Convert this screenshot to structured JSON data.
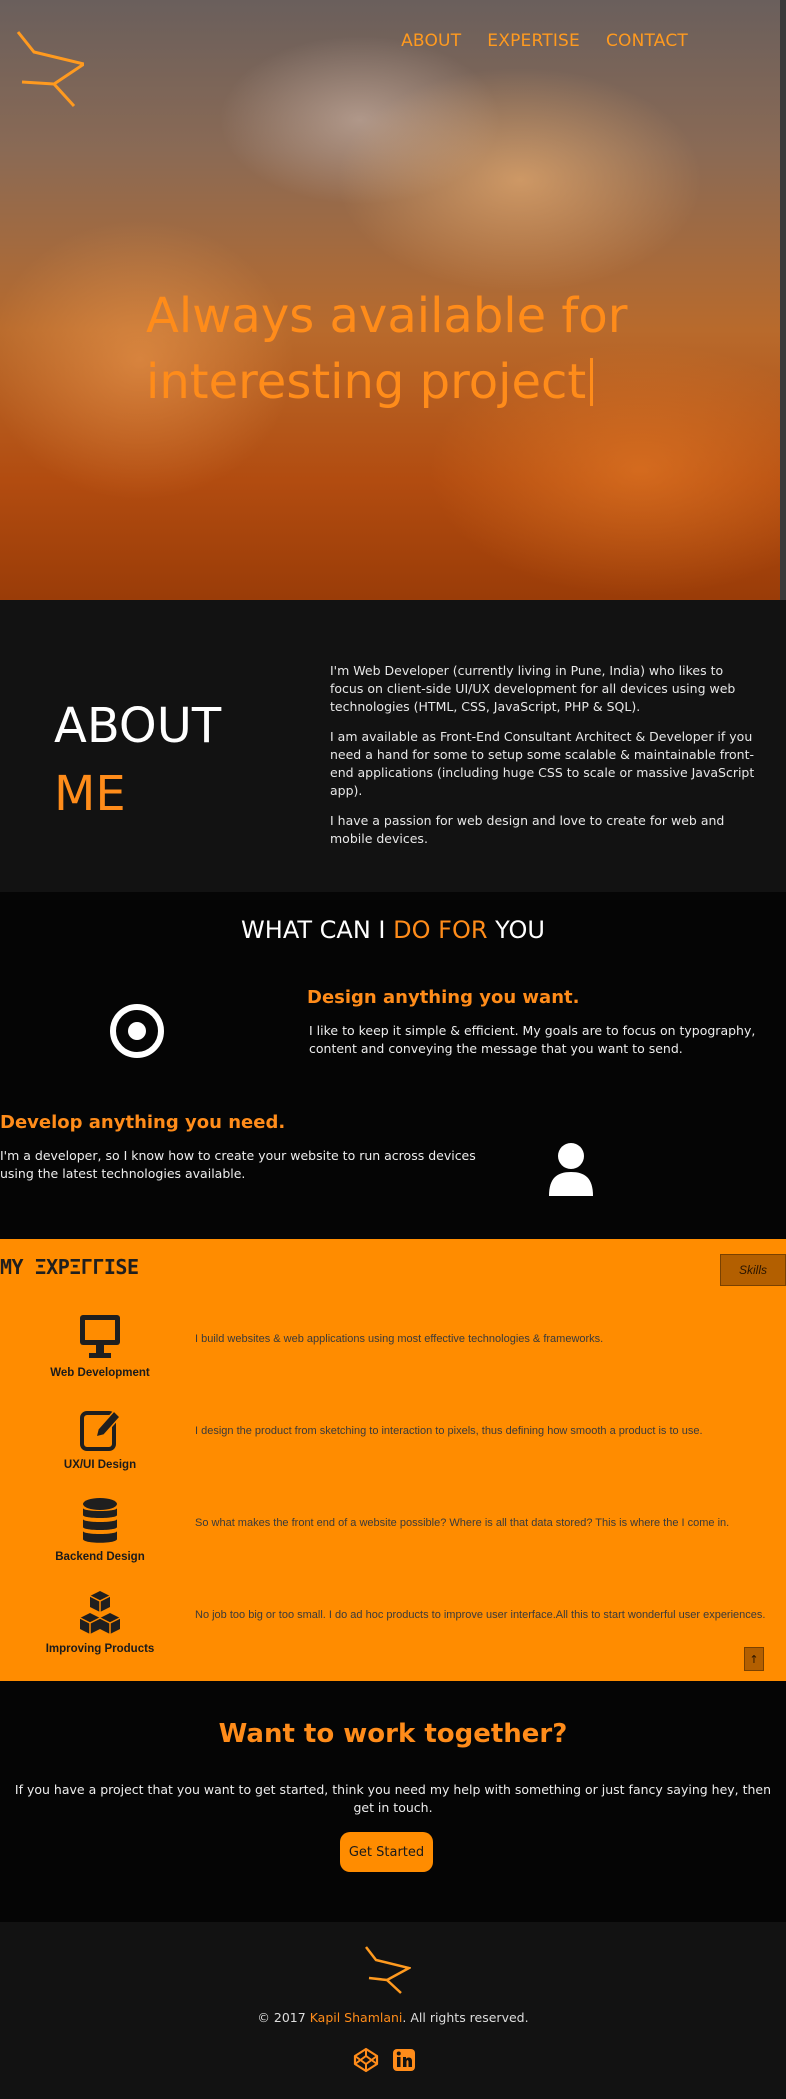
{
  "nav": {
    "items": [
      {
        "label": "ABOUT"
      },
      {
        "label": "EXPERTISE"
      },
      {
        "label": "CONTACT"
      }
    ]
  },
  "hero": {
    "line1": "Always available for",
    "line2": "interesting project"
  },
  "about": {
    "title_word1": "ABOUT",
    "title_word2": "ME",
    "paragraphs": [
      "I'm Web Developer (currently living in Pune, India) who likes to focus on client-side UI/UX development for all devices using web technologies (HTML, CSS, JavaScript, PHP & SQL).",
      "I am available as Front-End Consultant Architect & Developer if you need a hand for some to setup some scalable & maintainable front-end applications (including huge CSS to scale or massive JavaScript app).",
      "I have a passion for web design and love to create for web and mobile devices."
    ]
  },
  "services": {
    "title_pre": "WHAT CAN I ",
    "title_hl": "DO FOR",
    "title_post": " YOU",
    "items": [
      {
        "title": "Design anything you want.",
        "text": "I like to keep it simple & efficient. My goals are to focus on typography, content and conveying the message that you want to send.",
        "icon": "target-icon"
      },
      {
        "title": "Develop anything you need.",
        "text": "I'm a developer, so I know how to create your website to run across devices using the latest technologies available.",
        "icon": "user-icon"
      }
    ]
  },
  "expertise": {
    "title": "MY ΞXPΞΓΓISE",
    "skills_label": "Skills",
    "to_top": "↑",
    "items": [
      {
        "label": "Web Development",
        "desc": "I build websites & web applications using most effective technologies & frameworks.",
        "icon": "monitor-icon"
      },
      {
        "label": "UX/UI Design",
        "desc": "I design the product from sketching to interaction to pixels, thus defining how smooth a product is to use.",
        "icon": "pencil-square-icon"
      },
      {
        "label": "Backend Design",
        "desc": "So what makes the front end of a website possible? Where is all that data stored? This is where the I come in.",
        "icon": "database-icon"
      },
      {
        "label": "Improving Products",
        "desc": "No job too big or too small. I do ad hoc products to improve user interface.All this to start wonderful user experiences.",
        "icon": "cubes-icon"
      }
    ]
  },
  "cta": {
    "title": "Want to work together?",
    "text": "If you have a project that you want to get started, think you need my help with something or just fancy saying hey, then get in touch.",
    "button": "Get Started"
  },
  "footer": {
    "copyright_pre": "© 2017 ",
    "name": "Kapil Shamlani",
    "copyright_post": ". All rights reserved.",
    "social": [
      {
        "icon": "codepen-icon"
      },
      {
        "icon": "linkedin-icon"
      }
    ]
  },
  "colors": {
    "accent": "#ff8c1a",
    "expertise_bg": "#ff8c00",
    "dark_bg": "#050505",
    "section_bg": "#121212"
  }
}
